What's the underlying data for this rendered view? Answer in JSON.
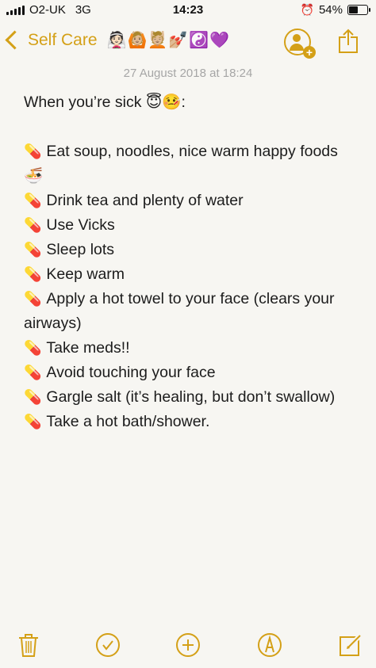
{
  "status_bar": {
    "carrier": "O2-UK",
    "network": "3G",
    "time": "14:23",
    "battery": "54%",
    "battery_level": 0.54
  },
  "nav": {
    "back_label": "Self Care",
    "title_emojis": "👰🏻🙆🏼💆🏼💅🏼☯️💜"
  },
  "note": {
    "date": "27 August 2018 at 18:24",
    "heading": "When you’re sick 😇🤒:",
    "bullet_icon": "💊",
    "items": [
      "Eat soup, noodles, nice warm happy foods 🍜",
      "Drink tea and plenty of water",
      "Use Vicks",
      "Sleep lots",
      "Keep warm",
      "Apply a hot towel to your face (clears your airways)",
      "Take meds!!",
      "Avoid touching your face",
      "Gargle salt (it’s healing, but don’t swallow)",
      "Take a hot bath/shower."
    ]
  },
  "toolbar": [
    "trash-icon",
    "checklist-icon",
    "add-icon",
    "markup-icon",
    "compose-icon"
  ],
  "colors": {
    "accent": "#d4a017",
    "background": "#f7f6f2",
    "date": "#a6a6a6"
  }
}
